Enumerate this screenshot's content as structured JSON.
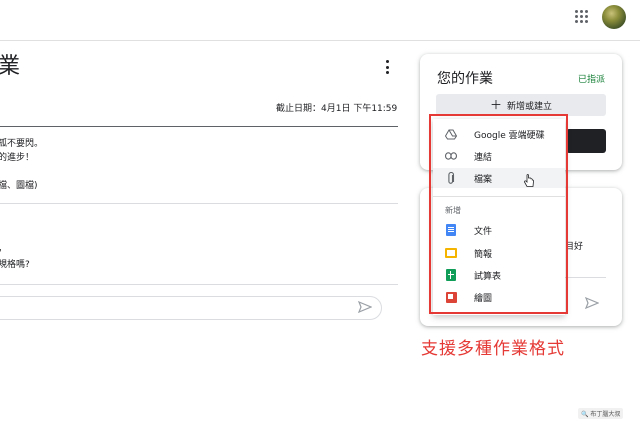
{
  "header": {
    "apps_icon": "apps-grid-icon",
    "avatar_icon": "user-avatar"
  },
  "main": {
    "title_fragment": "業",
    "due": "截止日期：4月1日 下午11:59",
    "description_lines": [
      "孤不要閃。",
      "的進步！",
      "檔、圖檔)"
    ],
    "comment_lines": [
      "規格嗎?"
    ],
    "comment_placeholder": ""
  },
  "work_card": {
    "title": "您的作業",
    "status": "已指派",
    "add_button_label": "新增或建立",
    "add_button_icon": "plus-icon"
  },
  "private_card": {
    "text_fragment": "目好"
  },
  "menu": {
    "items": [
      {
        "icon": "google-drive-icon",
        "label": "Google 雲端硬碟"
      },
      {
        "icon": "link-icon",
        "label": "連結"
      },
      {
        "icon": "paperclip-icon",
        "label": "檔案"
      }
    ],
    "new_section_label": "新增",
    "new_items": [
      {
        "icon": "docs-icon",
        "label": "文件"
      },
      {
        "icon": "slides-icon",
        "label": "簡報"
      },
      {
        "icon": "sheets-icon",
        "label": "試算表"
      },
      {
        "icon": "drawings-icon",
        "label": "繪圖"
      }
    ]
  },
  "annotation": {
    "caption": "支援多種作業格式",
    "color": "#e53935"
  },
  "watermark": "布丁腦大叔",
  "colors": {
    "assigned_green": "#188038",
    "docs_blue": "#4285f4",
    "slides_yellow": "#f4b400",
    "sheets_green": "#0f9d58",
    "drawings_red": "#db4437"
  }
}
